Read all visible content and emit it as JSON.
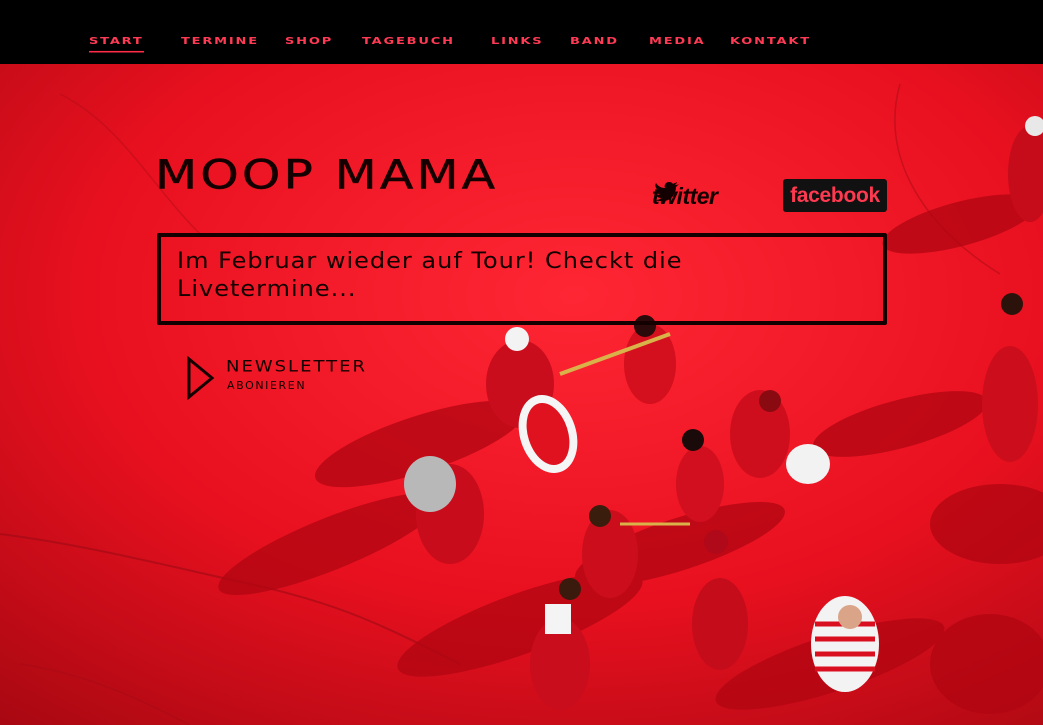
{
  "nav": {
    "items": [
      {
        "label": "Start"
      },
      {
        "label": "Termine"
      },
      {
        "label": "Shop"
      },
      {
        "label": "Tagebuch"
      },
      {
        "label": "Links"
      },
      {
        "label": "Band"
      },
      {
        "label": "Media"
      },
      {
        "label": "Kontakt"
      }
    ],
    "active": "Start"
  },
  "header": {
    "logo": "MOOP MAMA",
    "social": {
      "twitter": "twitter",
      "twitter_icon": "bird-icon",
      "facebook": "facebook"
    }
  },
  "news": {
    "text": "Im Februar wieder auf Tour! Checkt die Livetermine..."
  },
  "newsletter": {
    "title": "Newsletter",
    "subtitle": "abonieren",
    "icon": "play-arrow-icon"
  },
  "colors": {
    "background": "#000000",
    "accent": "#ff3a55",
    "hero_red": "#ec1022",
    "dark_text": "#140000"
  }
}
